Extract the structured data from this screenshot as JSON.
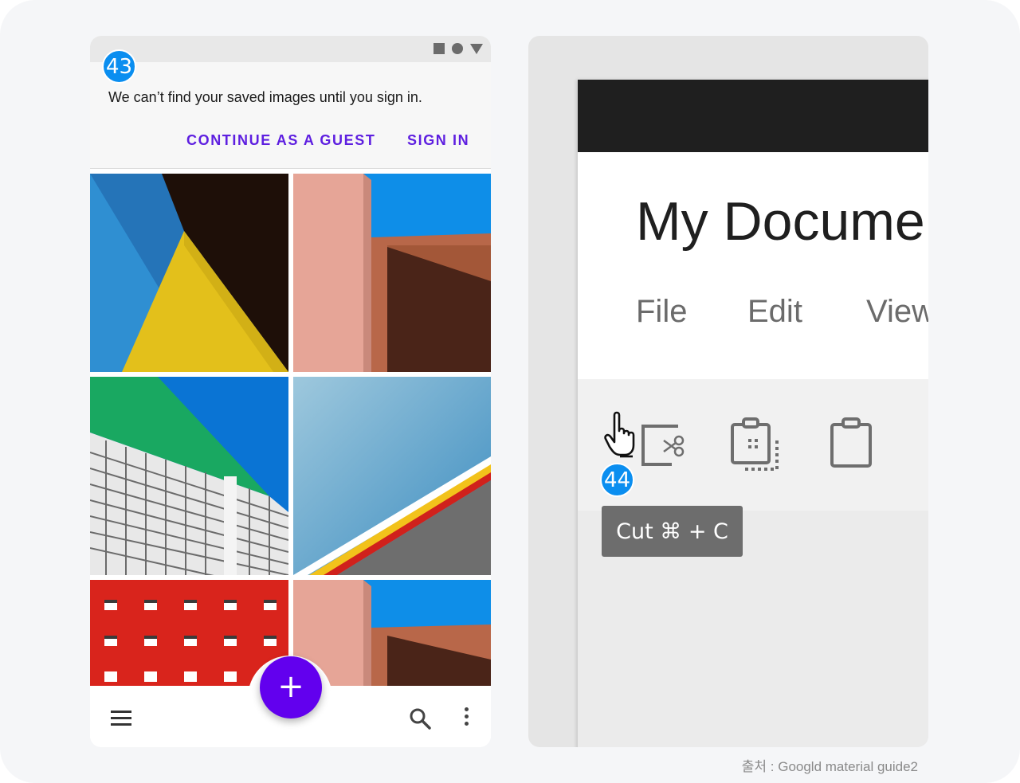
{
  "phone": {
    "badge": "43",
    "banner": {
      "message": "We can’t find your saved images until you sign in.",
      "continue_label": "CONTINUE AS A GUEST",
      "signin_label": "SIGN IN"
    },
    "status_icons": [
      "square-icon",
      "circle-icon",
      "triangle-icon"
    ],
    "fab_symbol": "+",
    "bottom_icons": [
      "menu-icon",
      "search-icon",
      "more-vert-icon"
    ],
    "accent_color": "#6200ee",
    "gallery": [
      "yellow-triangle-architecture",
      "pink-wall-blue-sky",
      "green-glass-building",
      "blue-sky-striped-edge",
      "red-windowed-facade",
      "pink-wall-blue-sky"
    ]
  },
  "desktop": {
    "badge": "44",
    "doc_title": "My Docume",
    "menu": {
      "file": "File",
      "edit": "Edit",
      "view": "View"
    },
    "tools": [
      "cut-icon",
      "copy-icon",
      "paste-icon"
    ],
    "tooltip": "Cut ⌘ + C",
    "cursor": "hand-pointer-icon"
  },
  "credit": "출처 : Googld material guide2"
}
